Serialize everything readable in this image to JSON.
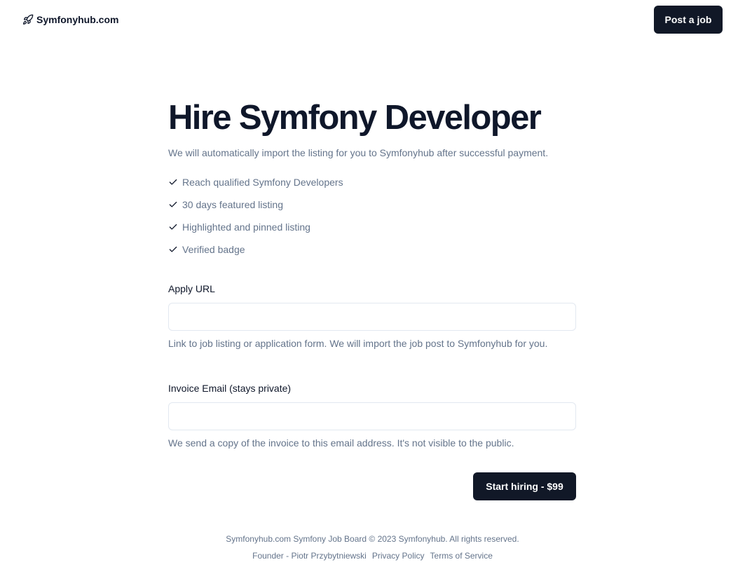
{
  "header": {
    "logo_icon": "rocket-icon",
    "logo_text": "Symfonyhub.com",
    "post_job_label": "Post a job"
  },
  "main": {
    "title": "Hire Symfony Developer",
    "subtitle": "We will automatically import the listing for you to Symfonyhub after successful payment.",
    "features_icon": "check-icon",
    "features": [
      "Reach qualified Symfony Developers",
      "30 days featured listing",
      "Highlighted and pinned listing",
      "Verified badge"
    ]
  },
  "form": {
    "apply_url": {
      "label": "Apply URL",
      "value": "",
      "help": "Link to job listing or application form. We will import the job post to Symfonyhub for you."
    },
    "invoice_email": {
      "label": "Invoice Email (stays private)",
      "value": "",
      "help": "We send a copy of the invoice to this email address. It's not visible to the public."
    },
    "submit_label": "Start hiring - $99"
  },
  "footer": {
    "copyright": "Symfonyhub.com Symfony Job Board © 2023 Symfonyhub. All rights reserved.",
    "links": [
      "Founder - Piotr Przybytniewski",
      "Privacy Policy",
      "Terms of Service"
    ]
  },
  "colors": {
    "primary_button": "#111827",
    "heading": "#0f172a",
    "muted_text": "#64748b",
    "input_border": "#e2e8f0"
  }
}
